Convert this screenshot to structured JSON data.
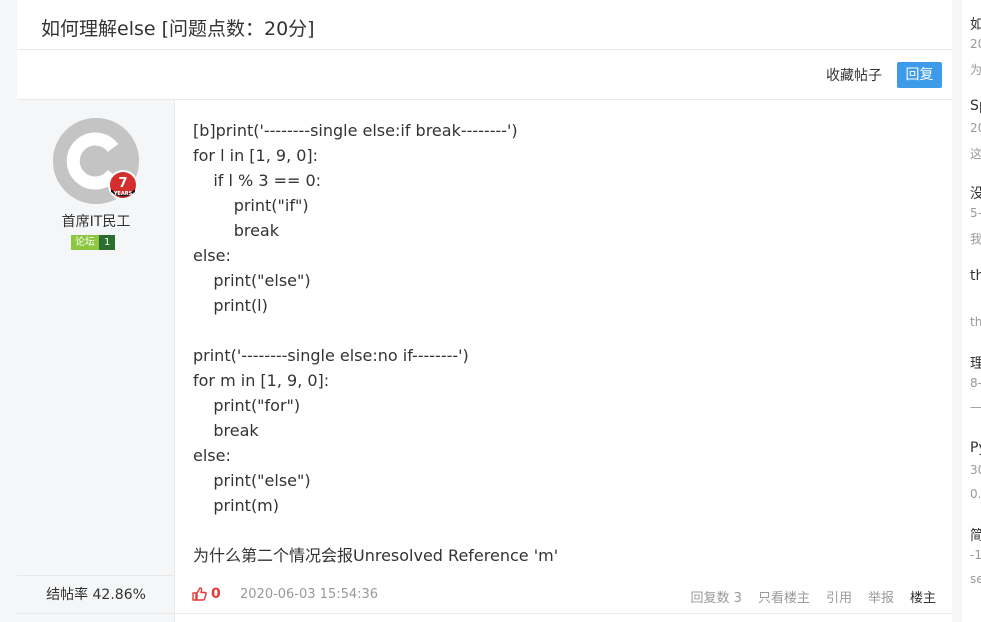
{
  "thread": {
    "title": "如何理解else [问题点数：20分]"
  },
  "actions": {
    "favorite_label": "收藏帖子",
    "reply_label": "回复",
    "reply_color": "#3d9be9"
  },
  "author": {
    "name": "首席IT民工",
    "years": "7",
    "years_label": "YEARS",
    "level_name": "论坛",
    "level_num": "1",
    "close_rate_label": "结帖率 42.86%"
  },
  "post": {
    "lines": [
      "[b]print('--------single else:if break--------')",
      "for l in [1, 9, 0]:",
      "    if l % 3 == 0:",
      "        print(\"if\")",
      "        break",
      "else:",
      "    print(\"else\")",
      "    print(l)",
      "",
      "print('--------single else:no if--------')",
      "for m in [1, 9, 0]:",
      "    print(\"for\")",
      "    break",
      "else:",
      "    print(\"else\")",
      "    print(m)",
      "",
      "为什么第二个情况会报Unresolved Reference 'm'"
    ],
    "likes": "0",
    "time": "2020-06-03 15:54:36"
  },
  "footer_links": {
    "replies": "回复数 3",
    "only_op": "只看楼主",
    "quote": "引用",
    "report": "举报",
    "op": "楼主"
  },
  "sidebar": {
    "items": [
      {
        "title": "如",
        "sub1": "20",
        "sub2": "为"
      },
      {
        "title": "Sp",
        "sub1": "20",
        "sub2": "这"
      },
      {
        "title": "没",
        "sub1": "5-",
        "sub2": "我"
      },
      {
        "title": "th",
        "sub1": "",
        "sub2": "th"
      },
      {
        "title": "理",
        "sub1": "8-",
        "sub2": "—"
      },
      {
        "title": "Py",
        "sub1": "30",
        "sub2": "0."
      },
      {
        "title": "简",
        "sub1": "-1",
        "sub2": "se"
      }
    ]
  }
}
